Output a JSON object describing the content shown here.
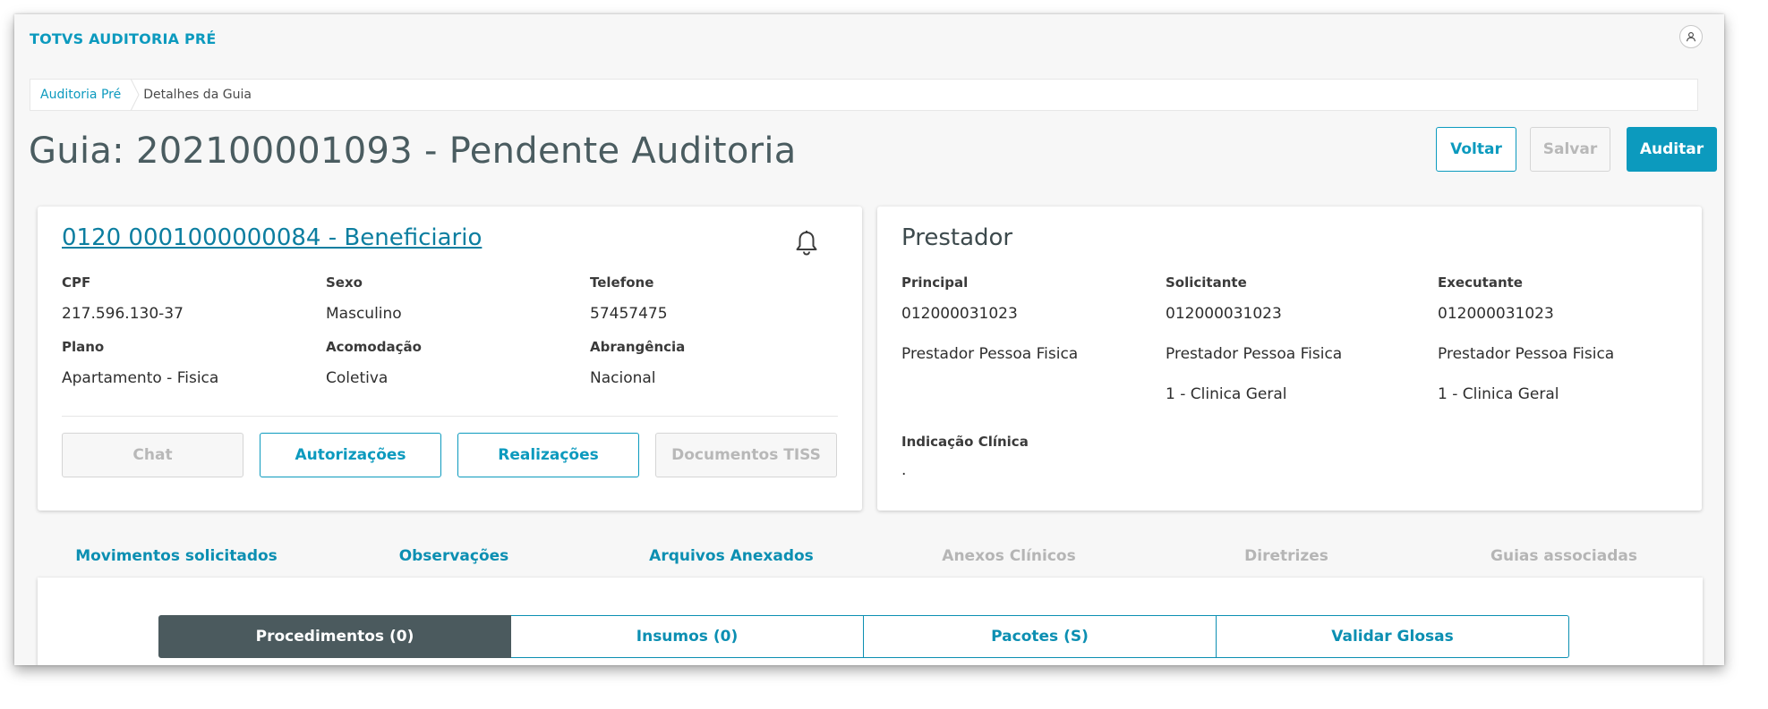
{
  "header": {
    "app_title": "TOTVS AUDITORIA PRÉ"
  },
  "breadcrumb": {
    "items": [
      "Auditoria Pré",
      "Detalhes da Guia"
    ]
  },
  "page": {
    "title": "Guia: 202100001093 - Pendente Auditoria"
  },
  "actions": {
    "voltar": "Voltar",
    "salvar": "Salvar",
    "auditar": "Auditar"
  },
  "beneficiario": {
    "title": "0120 0001000000084 - Beneficiario",
    "cpf_label": "CPF",
    "cpf": "217.596.130-37",
    "sexo_label": "Sexo",
    "sexo": "Masculino",
    "telefone_label": "Telefone",
    "telefone": "57457475",
    "plano_label": "Plano",
    "plano": "Apartamento - Fisica",
    "acomodacao_label": "Acomodação",
    "acomodacao": "Coletiva",
    "abrangencia_label": "Abrangência",
    "abrangencia": "Nacional",
    "buttons": {
      "chat": "Chat",
      "autorizacoes": "Autorizações",
      "realizacoes": "Realizações",
      "documentos": "Documentos TISS"
    }
  },
  "prestador": {
    "title": "Prestador",
    "principal_label": "Principal",
    "principal_code": "012000031023",
    "principal_name": "Prestador Pessoa Fisica",
    "solicitante_label": "Solicitante",
    "solicitante_code": "012000031023",
    "solicitante_name": "Prestador Pessoa Fisica",
    "solicitante_spec": "1 - Clinica Geral",
    "executante_label": "Executante",
    "executante_code": "012000031023",
    "executante_name": "Prestador Pessoa Fisica",
    "executante_spec": "1 - Clinica Geral",
    "indicacao_label": "Indicação Clínica",
    "indicacao_value": "."
  },
  "tabs": [
    {
      "label": "Movimentos solicitados",
      "state": "active"
    },
    {
      "label": "Observações",
      "state": "enabled"
    },
    {
      "label": "Arquivos Anexados",
      "state": "enabled"
    },
    {
      "label": "Anexos Clínicos",
      "state": "disabled"
    },
    {
      "label": "Diretrizes",
      "state": "disabled"
    },
    {
      "label": "Guias associadas",
      "state": "disabled"
    }
  ],
  "segments": [
    {
      "label": "Procedimentos (0)",
      "state": "active"
    },
    {
      "label": "Insumos (0)",
      "state": "enabled"
    },
    {
      "label": "Pacotes (S)",
      "state": "enabled"
    },
    {
      "label": "Validar Glosas",
      "state": "enabled"
    }
  ],
  "colors": {
    "primary": "#0c9abe",
    "segment_active": "#4b5a5e",
    "disabled_text": "#b5b5b5"
  }
}
